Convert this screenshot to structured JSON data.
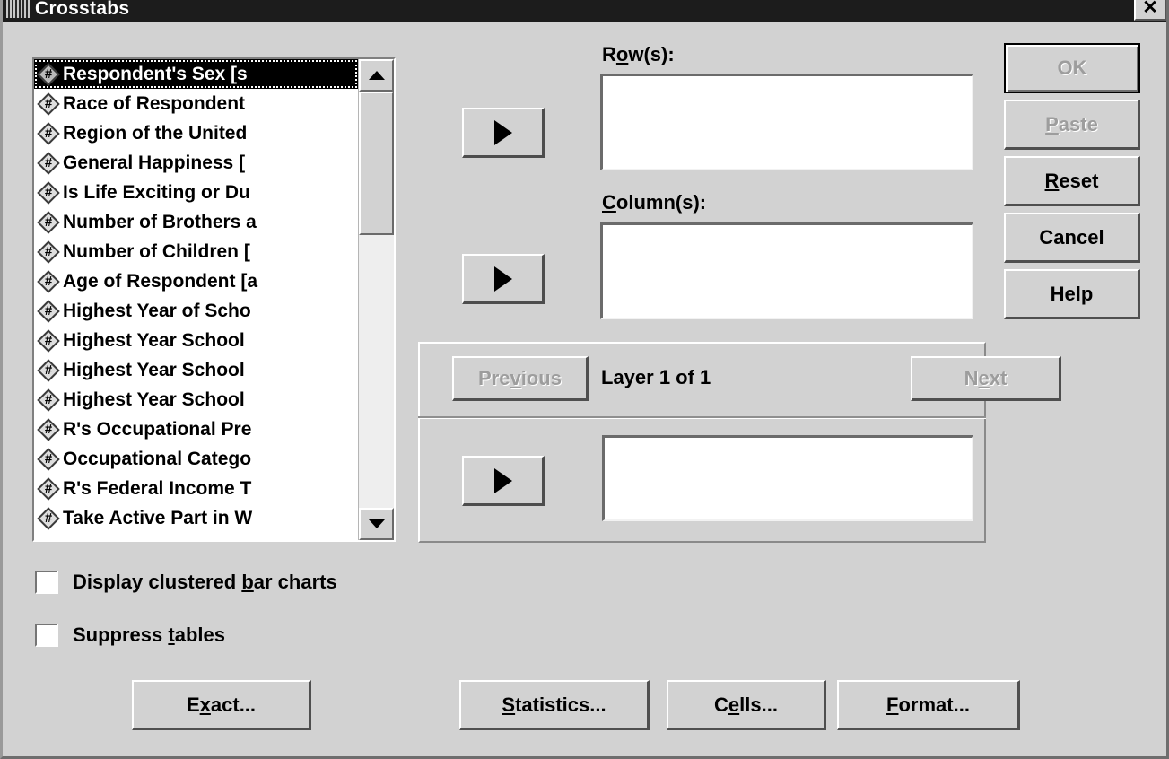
{
  "window": {
    "title": "Crosstabs",
    "icon": "spss-app-icon",
    "close_label": "✕"
  },
  "variable_list": {
    "selected_index": 0,
    "items": [
      {
        "icon": "numeric-variable-icon",
        "label": "Respondent's Sex [s"
      },
      {
        "icon": "numeric-variable-icon",
        "label": "Race of Respondent"
      },
      {
        "icon": "numeric-variable-icon",
        "label": "Region of the United"
      },
      {
        "icon": "numeric-variable-icon",
        "label": "General Happiness ["
      },
      {
        "icon": "numeric-variable-icon",
        "label": "Is Life Exciting or Du"
      },
      {
        "icon": "numeric-variable-icon",
        "label": "Number of Brothers a"
      },
      {
        "icon": "numeric-variable-icon",
        "label": "Number of Children ["
      },
      {
        "icon": "numeric-variable-icon",
        "label": "Age of Respondent [a"
      },
      {
        "icon": "numeric-variable-icon",
        "label": "Highest Year of Scho"
      },
      {
        "icon": "numeric-variable-icon",
        "label": "Highest Year School"
      },
      {
        "icon": "numeric-variable-icon",
        "label": "Highest Year School"
      },
      {
        "icon": "numeric-variable-icon",
        "label": "Highest Year School"
      },
      {
        "icon": "numeric-variable-icon",
        "label": "R's Occupational Pre"
      },
      {
        "icon": "numeric-variable-icon",
        "label": "Occupational Catego"
      },
      {
        "icon": "numeric-variable-icon",
        "label": "R's Federal Income T"
      },
      {
        "icon": "numeric-variable-icon",
        "label": "Take Active Part in W"
      }
    ],
    "scrollbar": {
      "up_arrow": "scroll-up-icon",
      "down_arrow": "scroll-down-icon"
    }
  },
  "fields": {
    "rows": {
      "label_pre": "R",
      "label_accel": "o",
      "label_post": "w(s):",
      "value": "",
      "move_button": "move-to-rows-arrow"
    },
    "columns": {
      "label_pre": "",
      "label_accel": "C",
      "label_post": "olumn(s):",
      "value": "",
      "move_button": "move-to-columns-arrow"
    },
    "layer": {
      "value": "",
      "move_button": "move-to-layer-arrow"
    }
  },
  "layer_panel": {
    "previous": {
      "pre": "Pre",
      "accel": "v",
      "post": "ious",
      "disabled": true
    },
    "next": {
      "pre": "N",
      "accel": "e",
      "post": "xt",
      "disabled": true
    },
    "status": "Layer 1 of 1"
  },
  "command_buttons": [
    {
      "pre": "",
      "accel": "",
      "post": "OK",
      "disabled": true,
      "default": true,
      "name": "ok-button"
    },
    {
      "pre": "",
      "accel": "P",
      "post": "aste",
      "disabled": true,
      "default": false,
      "name": "paste-button"
    },
    {
      "pre": "",
      "accel": "R",
      "post": "eset",
      "disabled": false,
      "default": false,
      "name": "reset-button"
    },
    {
      "pre": "",
      "accel": "",
      "post": "Cancel",
      "disabled": false,
      "default": false,
      "name": "cancel-button"
    },
    {
      "pre": "",
      "accel": "",
      "post": "Help",
      "disabled": false,
      "default": false,
      "name": "help-button"
    }
  ],
  "checkboxes": [
    {
      "pre": "Display clustered ",
      "accel": "b",
      "post": "ar charts",
      "checked": false,
      "name": "display-clustered-bar-charts-checkbox"
    },
    {
      "pre": "Suppress ",
      "accel": "t",
      "post": "ables",
      "checked": false,
      "name": "suppress-tables-checkbox"
    }
  ],
  "action_buttons": [
    {
      "pre": "E",
      "accel": "x",
      "post": "act...",
      "name": "exact-button"
    },
    {
      "pre": "",
      "accel": "S",
      "post": "tatistics...",
      "name": "statistics-button"
    },
    {
      "pre": "C",
      "accel": "e",
      "post": "lls...",
      "name": "cells-button"
    },
    {
      "pre": "",
      "accel": "F",
      "post": "ormat...",
      "name": "format-button"
    }
  ],
  "colors": {
    "dialog_face": "#d2d2d2",
    "titlebar": "#1c1c1c",
    "field_background": "#ffffff",
    "selection_background": "#000000",
    "selection_text": "#ffffff",
    "disabled_text": "#9d9d9d"
  }
}
